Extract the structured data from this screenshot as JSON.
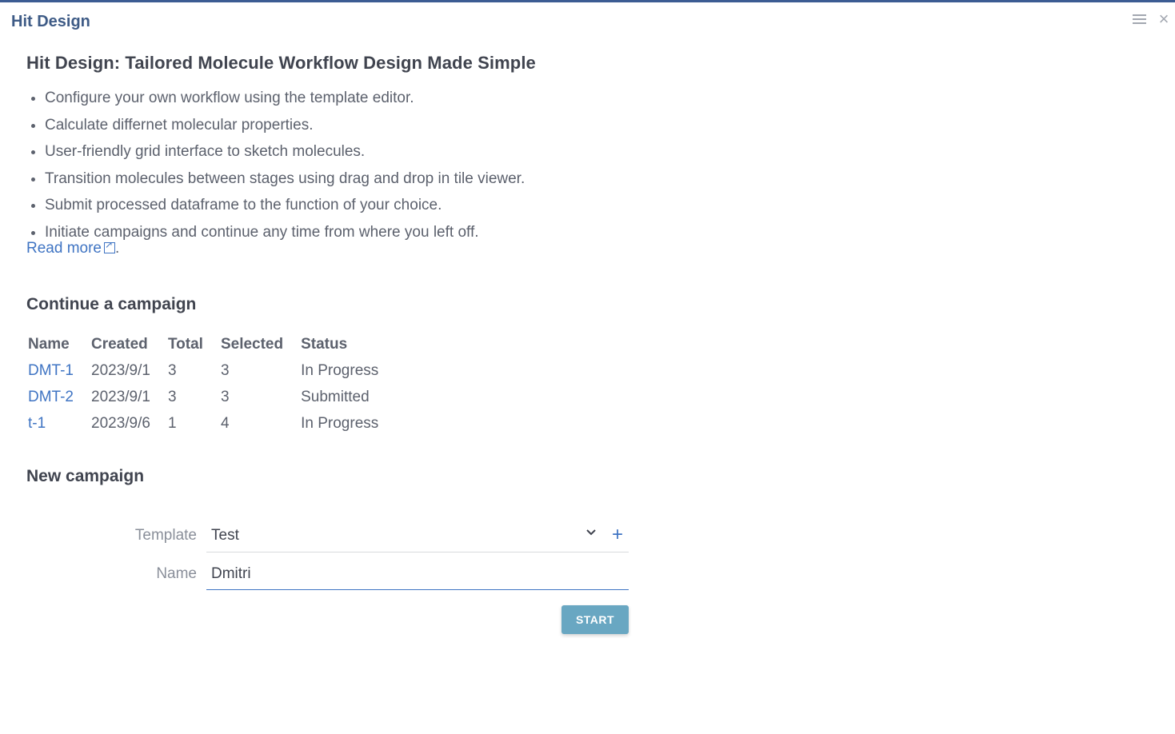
{
  "window": {
    "title": "Hit Design",
    "menu_icon": "hamburger-menu-icon",
    "close_icon": "close-icon",
    "accent_color": "#3c5c93"
  },
  "intro": {
    "heading": "Hit Design: Tailored Molecule Workflow Design Made Simple",
    "features": [
      "Configure your own workflow using the template editor.",
      "Calculate differnet molecular properties.",
      "User-friendly grid interface to sketch molecules.",
      "Transition molecules between stages using drag and drop in tile viewer.",
      "Submit processed dataframe to the function of your choice.",
      "Initiate campaigns and continue any time from where you left off."
    ],
    "read_more": "Read more",
    "read_more_suffix": ".",
    "read_more_icon": "external-link-icon"
  },
  "continue": {
    "title": "Continue a campaign",
    "columns": [
      "Name",
      "Created",
      "Total",
      "Selected",
      "Status"
    ],
    "rows": [
      {
        "name": "DMT-1",
        "created": "2023/9/1",
        "total": "3",
        "selected": "3",
        "status": "In Progress"
      },
      {
        "name": "DMT-2",
        "created": "2023/9/1",
        "total": "3",
        "selected": "3",
        "status": "Submitted"
      },
      {
        "name": "t-1",
        "created": "2023/9/6",
        "total": "1",
        "selected": "4",
        "status": "In Progress"
      }
    ]
  },
  "new_campaign": {
    "title": "New campaign",
    "template_label": "Template",
    "template_value": "Test",
    "add_icon": "+",
    "name_label": "Name",
    "name_value": "Dmitri",
    "start_label": "START"
  }
}
